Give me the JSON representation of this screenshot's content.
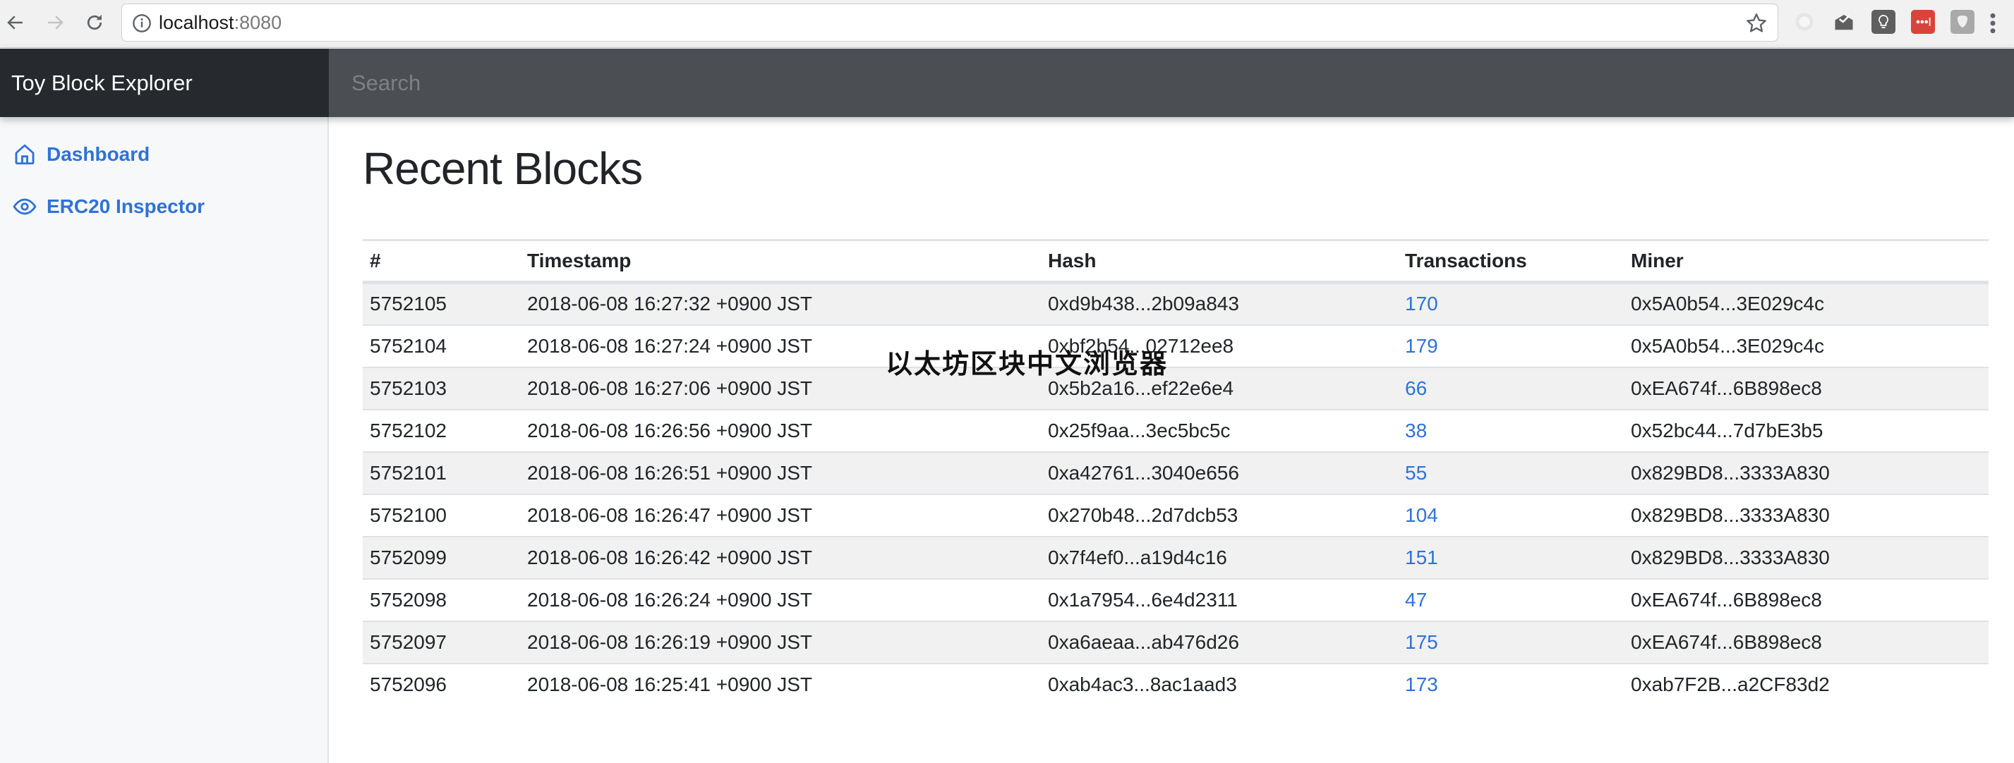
{
  "browser": {
    "url_host": "localhost",
    "url_port": ":8080",
    "extensions": [
      "sync-extension-icon",
      "inbox-checkmark-icon",
      "lightbulb-note-icon",
      "lastpass-icon",
      "shield-extension-icon"
    ]
  },
  "header": {
    "brand": "Toy Block Explorer",
    "search_placeholder": "Search"
  },
  "sidebar": {
    "items": [
      {
        "label": "Dashboard",
        "icon": "home-icon"
      },
      {
        "label": "ERC20 Inspector",
        "icon": "eye-icon"
      }
    ]
  },
  "main": {
    "title": "Recent Blocks",
    "table": {
      "columns": [
        "#",
        "Timestamp",
        "Hash",
        "Transactions",
        "Miner"
      ],
      "rows": [
        {
          "number": "5752105",
          "timestamp": "2018-06-08 16:27:32 +0900 JST",
          "hash": "0xd9b438...2b09a843",
          "transactions": "170",
          "miner": "0x5A0b54...3E029c4c"
        },
        {
          "number": "5752104",
          "timestamp": "2018-06-08 16:27:24 +0900 JST",
          "hash": "0xbf2b54...02712ee8",
          "transactions": "179",
          "miner": "0x5A0b54...3E029c4c"
        },
        {
          "number": "5752103",
          "timestamp": "2018-06-08 16:27:06 +0900 JST",
          "hash": "0x5b2a16...ef22e6e4",
          "transactions": "66",
          "miner": "0xEA674f...6B898ec8"
        },
        {
          "number": "5752102",
          "timestamp": "2018-06-08 16:26:56 +0900 JST",
          "hash": "0x25f9aa...3ec5bc5c",
          "transactions": "38",
          "miner": "0x52bc44...7d7bE3b5"
        },
        {
          "number": "5752101",
          "timestamp": "2018-06-08 16:26:51 +0900 JST",
          "hash": "0xa42761...3040e656",
          "transactions": "55",
          "miner": "0x829BD8...3333A830"
        },
        {
          "number": "5752100",
          "timestamp": "2018-06-08 16:26:47 +0900 JST",
          "hash": "0x270b48...2d7dcb53",
          "transactions": "104",
          "miner": "0x829BD8...3333A830"
        },
        {
          "number": "5752099",
          "timestamp": "2018-06-08 16:26:42 +0900 JST",
          "hash": "0x7f4ef0...a19d4c16",
          "transactions": "151",
          "miner": "0x829BD8...3333A830"
        },
        {
          "number": "5752098",
          "timestamp": "2018-06-08 16:26:24 +0900 JST",
          "hash": "0x1a7954...6e4d2311",
          "transactions": "47",
          "miner": "0xEA674f...6B898ec8"
        },
        {
          "number": "5752097",
          "timestamp": "2018-06-08 16:26:19 +0900 JST",
          "hash": "0xa6aeaa...ab476d26",
          "transactions": "175",
          "miner": "0xEA674f...6B898ec8"
        },
        {
          "number": "5752096",
          "timestamp": "2018-06-08 16:25:41 +0900 JST",
          "hash": "0xab4ac3...8ac1aad3",
          "transactions": "173",
          "miner": "0xab7F2B...a2CF83d2"
        }
      ]
    }
  },
  "overlay": {
    "watermark": "以太坊区块中文浏览器"
  },
  "colors": {
    "link": "#2e72d8",
    "brand_bg": "#26292d",
    "header_bg": "#4b4e53",
    "stripe": "#f1f1f1"
  }
}
